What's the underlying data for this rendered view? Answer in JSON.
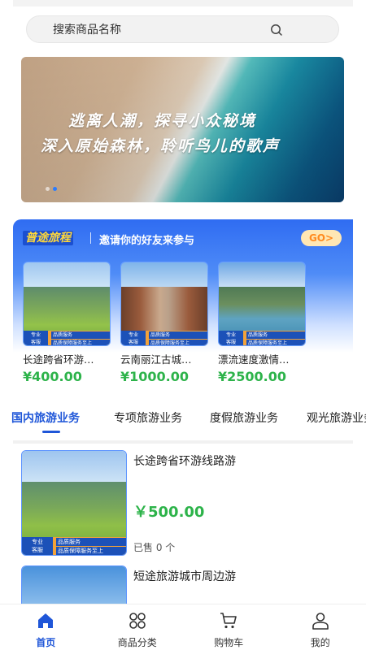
{
  "search": {
    "placeholder": "搜索商品名称",
    "icon": "search-icon"
  },
  "banner": {
    "line1": "逃离人潮，探寻小众秘境",
    "line2": "深入原始森林，聆听鸟儿的歌声",
    "slide_count": 2,
    "active_slide": 2
  },
  "promo": {
    "brand": "普途旅程",
    "invite": "邀请你的好友来参与",
    "go_label": "GO>",
    "card_badge_top": "专业",
    "card_badge_bottom": "客服",
    "card_bar_top": "品质服务",
    "card_bar_bottom": "品质保障服务至上",
    "cards": [
      {
        "name": "长途跨省环游…",
        "price": "¥400.00"
      },
      {
        "name": "云南丽江古城…",
        "price": "¥1000.00"
      },
      {
        "name": "漂流速度激情…",
        "price": "¥2500.00"
      }
    ]
  },
  "tabs": [
    "国内旅游业务",
    "专项旅游业务",
    "度假旅游业务",
    "观光旅游业务"
  ],
  "active_tab": 0,
  "products": [
    {
      "title": "长途跨省环游线路游",
      "price": "￥500.00",
      "sold": "已售 0 个",
      "badge_top": "专业",
      "badge_bottom": "客服",
      "bar_top": "品质服务",
      "bar_bottom": "品质保障服务至上"
    },
    {
      "title": "短途旅游城市周边游"
    }
  ],
  "nav": [
    {
      "label": "首页",
      "icon": "home-icon",
      "active": true
    },
    {
      "label": "商品分类",
      "icon": "category-icon",
      "active": false
    },
    {
      "label": "购物车",
      "icon": "cart-icon",
      "active": false
    },
    {
      "label": "我的",
      "icon": "user-icon",
      "active": false
    }
  ],
  "colors": {
    "accent": "#1f56d8",
    "price": "#2db34a",
    "go_bg": "#ffe7b4",
    "go_text": "#ff8a1f"
  }
}
